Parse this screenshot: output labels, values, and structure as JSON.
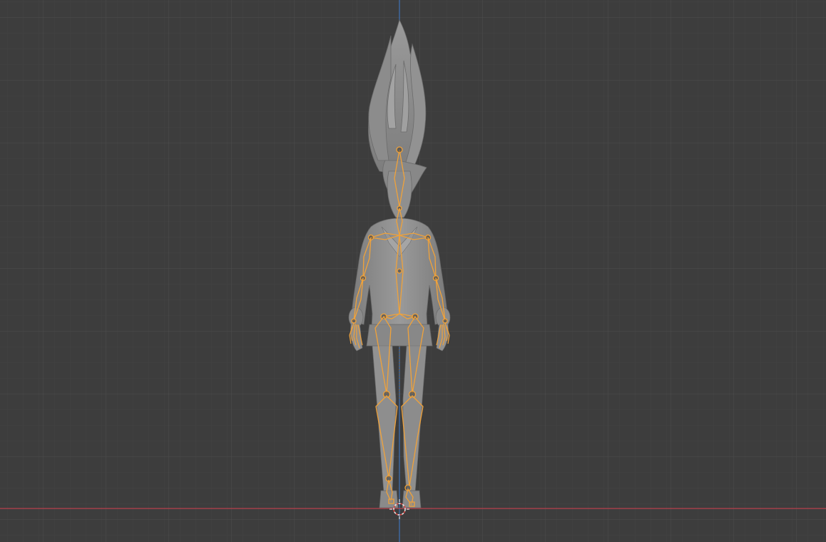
{
  "viewport": {
    "background": "#3d3d3d",
    "grid_minor_color": "#454545",
    "grid_major_color": "#4e4e4e",
    "x_axis_color": "#c2434f",
    "z_axis_color": "#3f73b8"
  },
  "model": {
    "mesh_color": "#8e8e8e",
    "mesh_shadow": "#6a6a6a",
    "armature_color": "#f0a23a",
    "armature_fill": "#8a8a8a"
  },
  "icons": {
    "origin": "3d-cursor-icon"
  }
}
